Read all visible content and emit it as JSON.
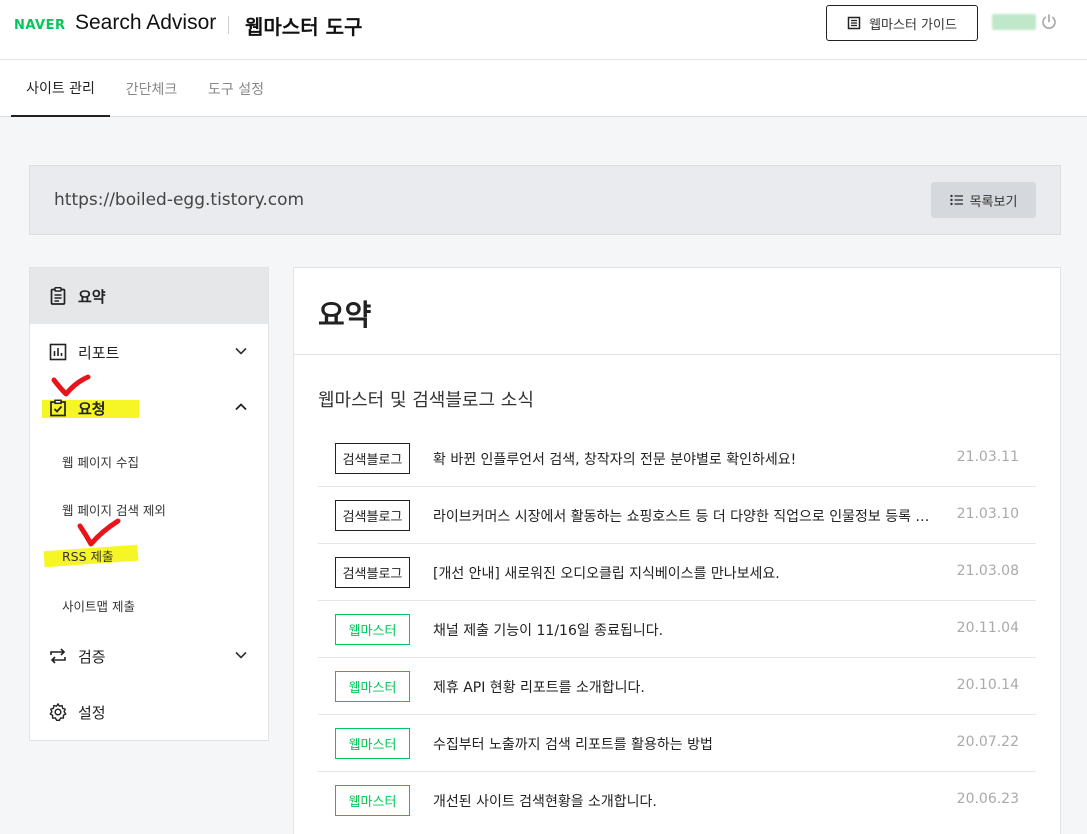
{
  "header": {
    "naver": "NAVER",
    "product": "Search Advisor",
    "tool": "웹마스터 도구",
    "guide_label": "웹마스터 가이드"
  },
  "tabs": [
    {
      "label": "사이트 관리",
      "active": true
    },
    {
      "label": "간단체크",
      "active": false
    },
    {
      "label": "도구 설정",
      "active": false
    }
  ],
  "site": {
    "url": "https://boiled-egg.tistory.com",
    "list_label": "목록보기"
  },
  "sidebar": {
    "items": [
      {
        "label": "요약",
        "icon": "clipboard-icon"
      },
      {
        "label": "리포트",
        "icon": "chart-icon"
      },
      {
        "label": "요청",
        "icon": "checkbox-icon"
      },
      {
        "label": "검증",
        "icon": "repeat-icon"
      },
      {
        "label": "설정",
        "icon": "gear-icon"
      }
    ],
    "sub_items": [
      "웹 페이지 수집",
      "웹 페이지 검색 제외",
      "RSS 제출",
      "사이트맵 제출"
    ]
  },
  "main": {
    "title": "요약",
    "news_title": "웹마스터 및 검색블로그 소식",
    "news": [
      {
        "badge": "검색블로그",
        "text": "확 바뀐 인플루언서 검색, 창작자의 전문 분야별로 확인하세요!",
        "date": "21.03.11"
      },
      {
        "badge": "검색블로그",
        "text": "라이브커머스 시장에서 활동하는 쇼핑호스트 등 더 다양한 직업으로 인물정보 등록 가능",
        "date": "21.03.10"
      },
      {
        "badge": "검색블로그",
        "text": "[개선 안내] 새로워진 오디오클립 지식베이스를 만나보세요.",
        "date": "21.03.08"
      },
      {
        "badge": "웹마스터",
        "text": "채널 제출 기능이 11/16일 종료됩니다.",
        "date": "20.11.04"
      },
      {
        "badge": "웹마스터",
        "text": "제휴 API 현황 리포트를 소개합니다.",
        "date": "20.10.14"
      },
      {
        "badge": "웹마스터",
        "text": "수집부터 노출까지 검색 리포트를 활용하는 방법",
        "date": "20.07.22"
      },
      {
        "badge": "웹마스터",
        "text": "개선된 사이트 검색현황을 소개합니다.",
        "date": "20.06.23"
      }
    ]
  },
  "colors": {
    "naver_green": "#03c75a",
    "highlight": "#f5f500",
    "annotation_red": "#e8141c"
  }
}
